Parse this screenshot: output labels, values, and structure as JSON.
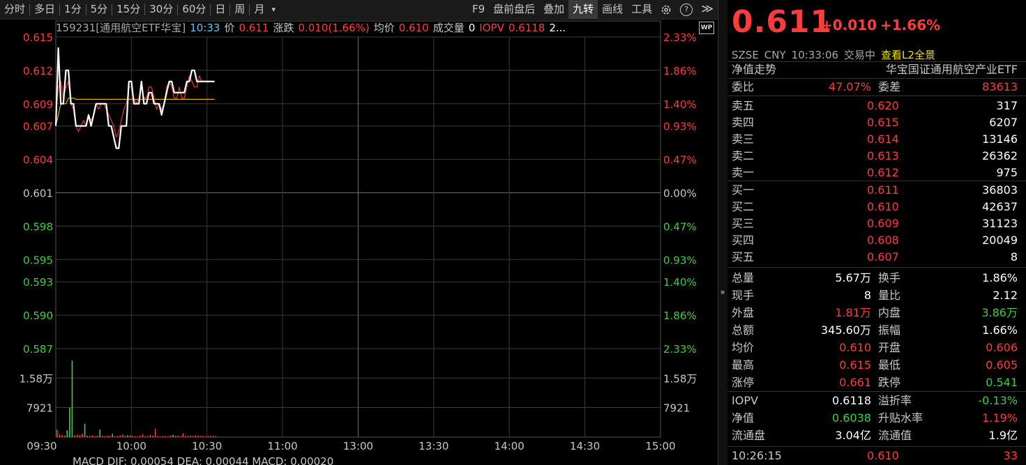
{
  "toolbar": {
    "left_items": [
      "分时",
      "多日",
      "1分",
      "5分",
      "15分",
      "30分",
      "60分",
      "日",
      "周",
      "月"
    ],
    "dropdown_glyph": "▾",
    "right_items": [
      "F9",
      "盘前盘后",
      "叠加",
      "九转",
      "画线",
      "工具"
    ],
    "active_item": "九转",
    "help_glyph": "?",
    "expand_glyph": "≫"
  },
  "info": {
    "name": "159231[通用航空ETF华宝]",
    "time": "10:33",
    "price_label": "价",
    "price": "0.611",
    "change_label": "涨跌",
    "change": "0.010(1.66%)",
    "avg_label": "均价",
    "avg": "0.610",
    "volume_label": "成交量",
    "volume": "0",
    "iopv_label": "IOPV",
    "iopv": "0.6118",
    "trailing": "2...",
    "wp_badge": "WP"
  },
  "chart_data": {
    "type": "line",
    "title": "",
    "prev_close": 0.601,
    "y_ticks": [
      "0.615",
      "0.612",
      "0.609",
      "0.607",
      "0.604",
      "0.601",
      "0.598",
      "0.595",
      "0.593",
      "0.590",
      "0.587"
    ],
    "y_tick_values": [
      0.615,
      0.612,
      0.609,
      0.607,
      0.604,
      0.601,
      0.598,
      0.595,
      0.593,
      0.59,
      0.587
    ],
    "pct_ticks": [
      "2.33%",
      "1.86%",
      "1.40%",
      "0.93%",
      "0.47%",
      "0.00%",
      "0.47%",
      "0.93%",
      "1.40%",
      "1.86%",
      "2.33%"
    ],
    "vol_ticks": [
      "1.58万",
      "7921"
    ],
    "vol_tick_values": [
      15800,
      7921
    ],
    "x_ticks": [
      "09:30",
      "10:00",
      "10:30",
      "11:00",
      "13:00",
      "13:30",
      "14:00",
      "14:30",
      "15:00"
    ],
    "total_minutes": 240,
    "series": [
      {
        "name": "价",
        "color": "#ffffff",
        "values": [
          0.607,
          0.614,
          0.609,
          0.609,
          0.612,
          0.612,
          0.609,
          0.609,
          0.607,
          0.607,
          0.607,
          0.607,
          0.607,
          0.608,
          0.607,
          0.608,
          0.609,
          0.609,
          0.609,
          0.609,
          0.609,
          0.607,
          0.607,
          0.606,
          0.605,
          0.605,
          0.607,
          0.607,
          0.607,
          0.611,
          0.611,
          0.609,
          0.609,
          0.609,
          0.611,
          0.609,
          0.609,
          0.61,
          0.61,
          0.609,
          0.609,
          0.609,
          0.608,
          0.609,
          0.61,
          0.611,
          0.611,
          0.61,
          0.61,
          0.61,
          0.61,
          0.61,
          0.611,
          0.611,
          0.612,
          0.612,
          0.611,
          0.611,
          0.611,
          0.611,
          0.611,
          0.611,
          0.611,
          0.611
        ]
      },
      {
        "name": "均价",
        "color": "#f0c000",
        "values": [
          0.607,
          0.608,
          0.609,
          0.609,
          0.609,
          0.6095,
          0.6095,
          0.6095,
          0.6094,
          0.6094,
          0.6094,
          0.6094,
          0.6094,
          0.6094,
          0.6094,
          0.6094,
          0.6094,
          0.6094,
          0.6094,
          0.6094,
          0.6094,
          0.6094,
          0.6094,
          0.6094,
          0.6094,
          0.6094,
          0.6094,
          0.6094,
          0.6094,
          0.6094,
          0.6094,
          0.6094,
          0.6094,
          0.6094,
          0.6094,
          0.6094,
          0.6094,
          0.6094,
          0.6094,
          0.6094,
          0.6094,
          0.6094,
          0.6094,
          0.6094,
          0.6094,
          0.6094,
          0.6094,
          0.6094,
          0.6094,
          0.6094,
          0.6094,
          0.6094,
          0.6094,
          0.6094,
          0.6094,
          0.6094,
          0.6094,
          0.6094,
          0.6094,
          0.6094,
          0.6094,
          0.6094,
          0.6094,
          0.6094
        ]
      },
      {
        "name": "IOPV",
        "color": "#ff3b3b",
        "values": [
          0.608,
          0.6105,
          0.611,
          0.6095,
          0.6105,
          0.611,
          0.609,
          0.6085,
          0.607,
          0.6065,
          0.607,
          0.6075,
          0.607,
          0.608,
          0.6075,
          0.608,
          0.609,
          0.6085,
          0.609,
          0.609,
          0.6085,
          0.608,
          0.6075,
          0.607,
          0.606,
          0.6065,
          0.6075,
          0.6085,
          0.609,
          0.6105,
          0.6105,
          0.6095,
          0.609,
          0.6095,
          0.6105,
          0.6095,
          0.6095,
          0.6105,
          0.6105,
          0.6095,
          0.6085,
          0.609,
          0.6085,
          0.609,
          0.6105,
          0.611,
          0.6105,
          0.6095,
          0.6095,
          0.6105,
          0.6095,
          0.6095,
          0.6105,
          0.6115,
          0.611,
          0.6105,
          0.6105,
          0.6115,
          0.611,
          0.611,
          0.611,
          0.611,
          0.611,
          0.611
        ]
      }
    ],
    "volume": [
      2000,
      800,
      600,
      400,
      1800,
      7900,
      20500,
      500,
      700,
      600,
      900,
      3600,
      400,
      300,
      500,
      300,
      400,
      2000,
      300,
      200,
      400,
      300,
      900,
      200,
      300,
      400,
      700,
      300,
      500,
      500,
      300,
      200,
      200,
      400,
      800,
      200,
      300,
      600,
      400,
      2200,
      300,
      200,
      300,
      300,
      200,
      400,
      600,
      300,
      400,
      200,
      1000,
      300,
      300,
      400,
      300,
      500,
      400,
      300,
      300,
      200,
      300,
      300,
      300,
      300
    ],
    "volume_colors": [
      "red",
      "red",
      "red",
      "red",
      "green",
      "green",
      "green",
      "red",
      "red",
      "red",
      "red",
      "green",
      "red",
      "red",
      "red",
      "red",
      "red",
      "green",
      "red",
      "red",
      "red",
      "red",
      "green",
      "red",
      "red",
      "red",
      "red",
      "red",
      "green",
      "red",
      "red",
      "red",
      "red",
      "red",
      "red",
      "red",
      "red",
      "red",
      "red",
      "red",
      "red",
      "red",
      "red",
      "red",
      "red",
      "red",
      "green",
      "red",
      "red",
      "red",
      "red",
      "red",
      "red",
      "red",
      "red",
      "red",
      "red",
      "red",
      "red",
      "red",
      "red",
      "red",
      "red",
      "red"
    ],
    "volume_ymax": 23700
  },
  "macd_label": "MACD  DIF: 0.00054  DEA: 0.00044  MACD: 0.00020",
  "panel": {
    "price": "0.611",
    "change": "+0.010",
    "change_pct": "+1.66%",
    "exchange": "SZSE",
    "currency": "CNY",
    "time": "10:33:06",
    "status": "交易中",
    "l2_link": "查看L2全景",
    "nav_trend_label": "净值走势",
    "fund_name": "华宝国证通用航空产业ETF",
    "commission_ratio_label": "委比",
    "commission_ratio": "47.07%",
    "commission_diff_label": "委差",
    "commission_diff": "83613",
    "asks": [
      {
        "label": "卖五",
        "price": "0.620",
        "volume": "317"
      },
      {
        "label": "卖四",
        "price": "0.615",
        "volume": "6207"
      },
      {
        "label": "卖三",
        "price": "0.614",
        "volume": "13146"
      },
      {
        "label": "卖二",
        "price": "0.613",
        "volume": "26362"
      },
      {
        "label": "卖一",
        "price": "0.612",
        "volume": "975"
      }
    ],
    "bids": [
      {
        "label": "买一",
        "price": "0.611",
        "volume": "36803"
      },
      {
        "label": "买二",
        "price": "0.610",
        "volume": "42637"
      },
      {
        "label": "买三",
        "price": "0.609",
        "volume": "31123"
      },
      {
        "label": "买四",
        "price": "0.608",
        "volume": "20049"
      },
      {
        "label": "买五",
        "price": "0.607",
        "volume": "8"
      }
    ],
    "stats": [
      {
        "l1": "总量",
        "v1": "5.67万",
        "c1": "white",
        "l2": "换手",
        "v2": "1.86%",
        "c2": "white"
      },
      {
        "l1": "现手",
        "v1": "8",
        "c1": "white",
        "l2": "量比",
        "v2": "2.12",
        "c2": "white"
      },
      {
        "l1": "外盘",
        "v1": "1.81万",
        "c1": "red",
        "l2": "内盘",
        "v2": "3.86万",
        "c2": "green"
      },
      {
        "l1": "总额",
        "v1": "345.60万",
        "c1": "white",
        "l2": "振幅",
        "v2": "1.66%",
        "c2": "white"
      },
      {
        "l1": "均价",
        "v1": "0.610",
        "c1": "red",
        "l2": "开盘",
        "v2": "0.606",
        "c2": "red"
      },
      {
        "l1": "最高",
        "v1": "0.615",
        "c1": "red",
        "l2": "最低",
        "v2": "0.605",
        "c2": "red"
      },
      {
        "l1": "涨停",
        "v1": "0.661",
        "c1": "red",
        "l2": "跌停",
        "v2": "0.541",
        "c2": "green"
      }
    ],
    "stats2": [
      {
        "l1": "IOPV",
        "v1": "0.6118",
        "c1": "white",
        "l2": "溢折率",
        "v2": "-0.13%",
        "c2": "green"
      },
      {
        "l1": "净值",
        "v1": "0.6038",
        "c1": "green",
        "l2": "升贴水率",
        "v2": "1.19%",
        "c2": "red"
      },
      {
        "l1": "流通盘",
        "v1": "3.04亿",
        "c1": "white",
        "l2": "流通值",
        "v2": "1.9亿",
        "c2": "white"
      }
    ],
    "last_trade": {
      "time": "10:26:15",
      "price": "0.610",
      "volume": "33"
    },
    "collapse_glyph": "»"
  },
  "colors": {
    "up": "#ff3b3b",
    "down": "#3ecf3e",
    "grid": "#3a3a3a",
    "frame": "#555555"
  }
}
